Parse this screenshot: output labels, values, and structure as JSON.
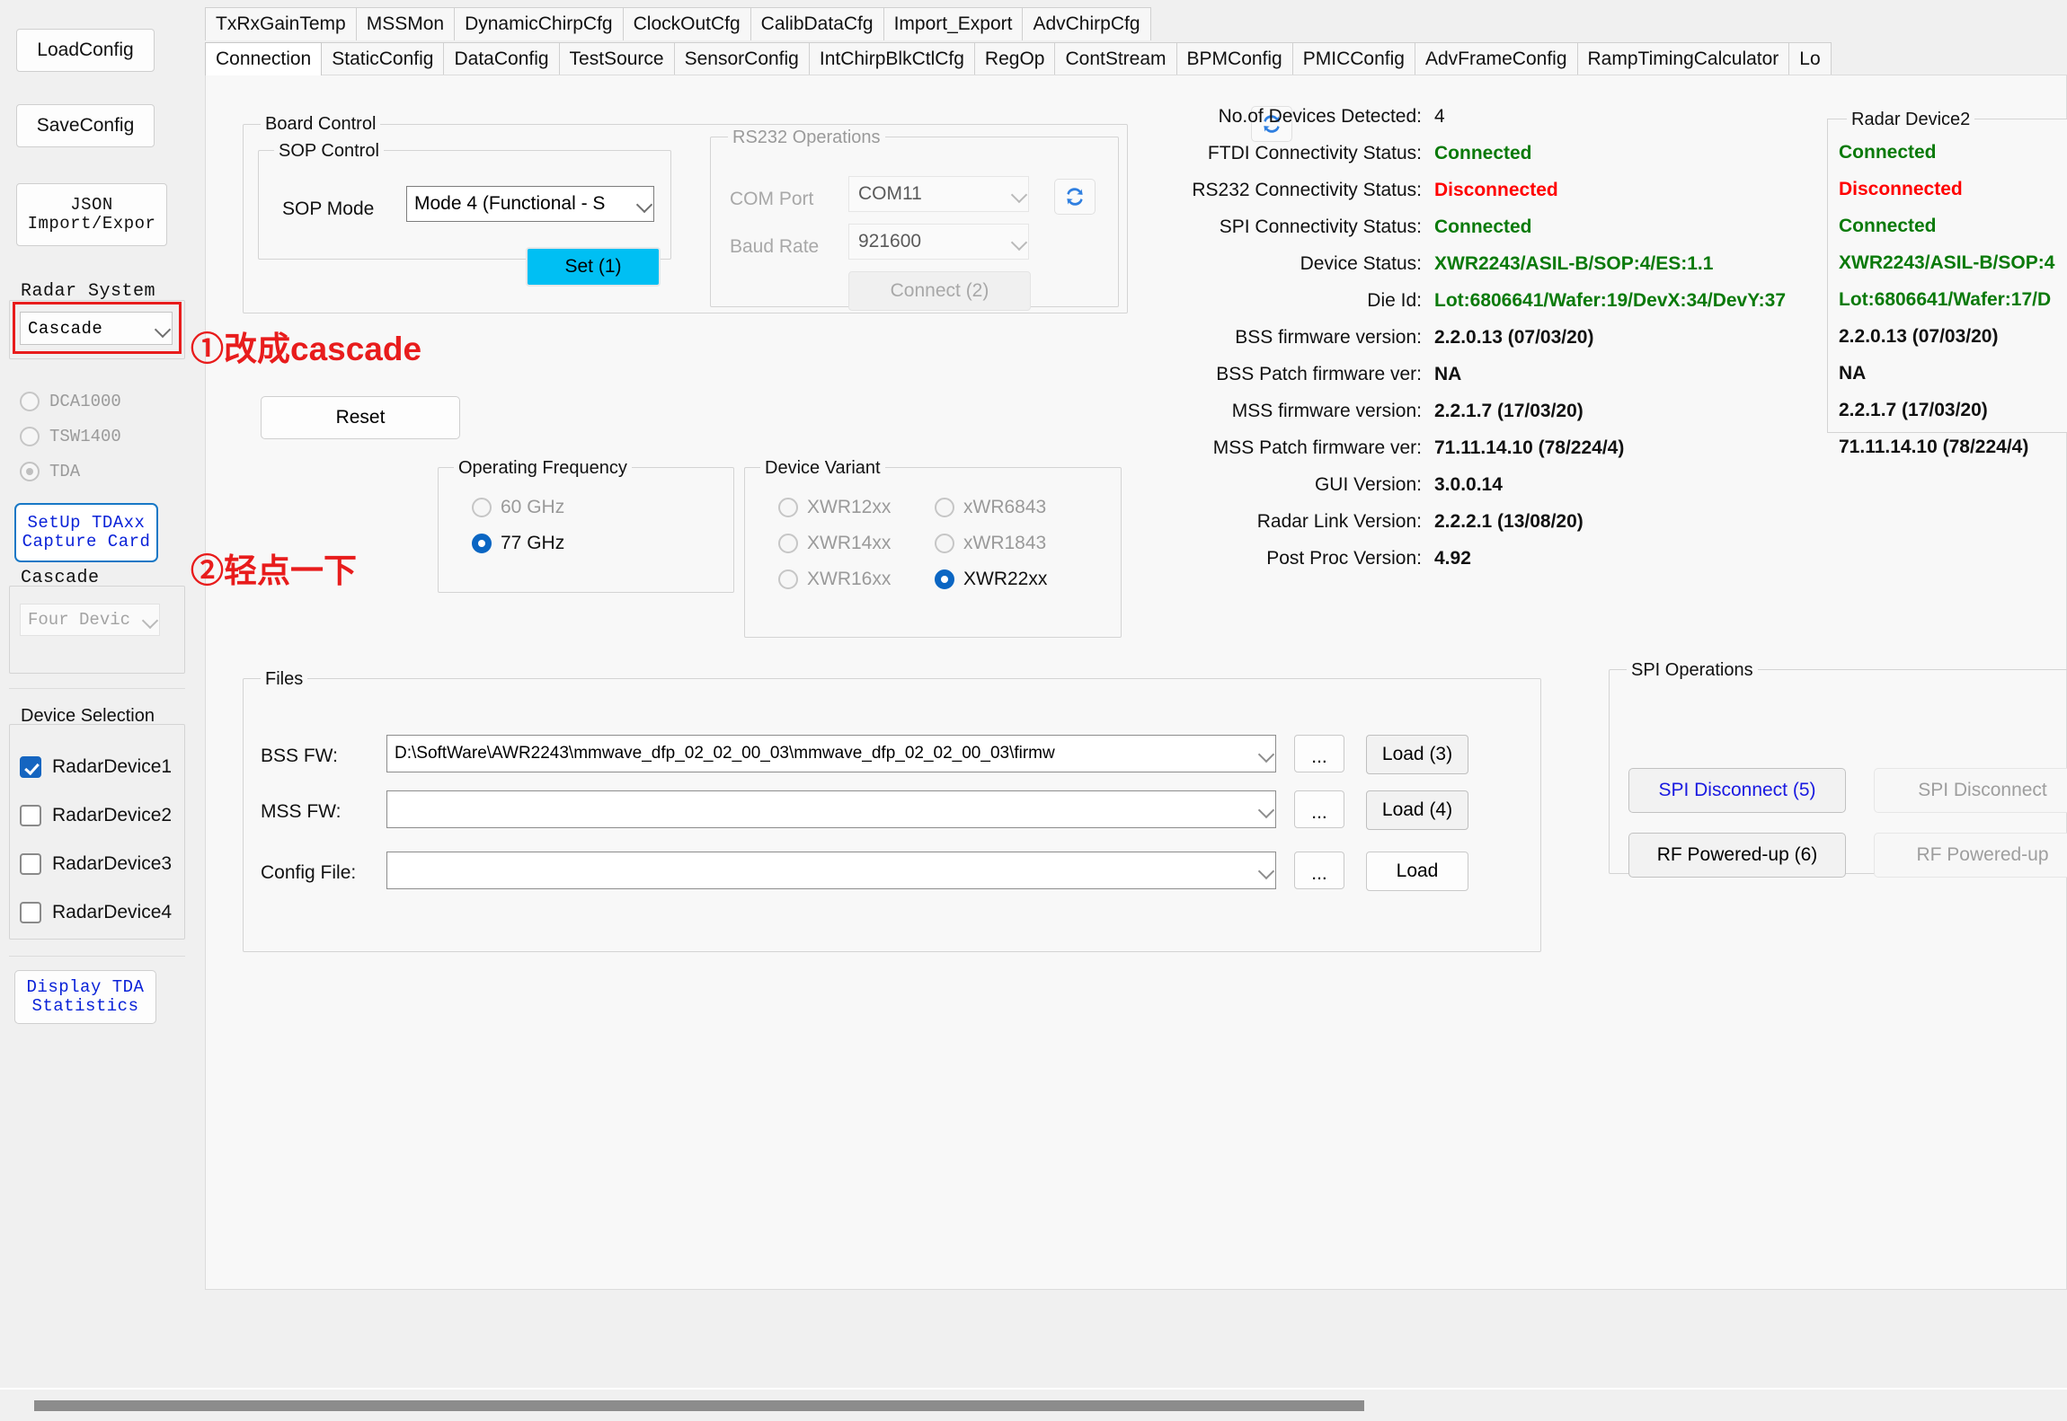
{
  "sidebar": {
    "load_config": "LoadConfig",
    "save_config": "SaveConfig",
    "json_button": "JSON\nImport/Expor",
    "radar_system": {
      "group_label": "Radar System",
      "selected": "Cascade"
    },
    "capture_radios": [
      {
        "label": "DCA1000",
        "selected": false
      },
      {
        "label": "TSW1400",
        "selected": false
      },
      {
        "label": "TDA",
        "selected": true
      }
    ],
    "setup_tda_button": "SetUp TDAxx\nCapture Card",
    "cascade": {
      "group_label": "Cascade",
      "selected": "Four Devic"
    },
    "device_selection": {
      "group_label": "Device Selection",
      "items": [
        {
          "label": "RadarDevice1",
          "checked": true
        },
        {
          "label": "RadarDevice2",
          "checked": false
        },
        {
          "label": "RadarDevice3",
          "checked": false
        },
        {
          "label": "RadarDevice4",
          "checked": false
        }
      ]
    },
    "display_tda_button": "Display TDA\nStatistics"
  },
  "tabs": {
    "row1": [
      "TxRxGainTemp",
      "MSSMon",
      "DynamicChirpCfg",
      "ClockOutCfg",
      "CalibDataCfg",
      "Import_Export",
      "AdvChirpCfg"
    ],
    "row2": [
      "Connection",
      "StaticConfig",
      "DataConfig",
      "TestSource",
      "SensorConfig",
      "IntChirpBlkCtlCfg",
      "RegOp",
      "ContStream",
      "BPMConfig",
      "PMICConfig",
      "AdvFrameConfig",
      "RampTimingCalculator",
      "Lo"
    ],
    "active": "Connection"
  },
  "board_control": {
    "group_label": "Board Control",
    "sop_control": {
      "group_label": "SOP Control",
      "sop_mode_label": "SOP Mode",
      "sop_mode_value": "Mode 4 (Functional - S",
      "set_button": "Set (1)"
    },
    "reset_button": "Reset"
  },
  "rs232": {
    "group_label": "RS232 Operations",
    "com_port_label": "COM Port",
    "com_port_value": "COM11",
    "baud_rate_label": "Baud Rate",
    "baud_rate_value": "921600",
    "connect_button": "Connect (2)"
  },
  "status": [
    {
      "key": "No.of Devices Detected:",
      "value": "4",
      "style": "plain"
    },
    {
      "key": "FTDI Connectivity Status:",
      "value": "Connected",
      "style": "green"
    },
    {
      "key": "RS232 Connectivity Status:",
      "value": "Disconnected",
      "style": "red"
    },
    {
      "key": "SPI Connectivity Status:",
      "value": "Connected",
      "style": "green"
    },
    {
      "key": "Device Status:",
      "value": "XWR2243/ASIL-B/SOP:4/ES:1.1",
      "style": "green"
    },
    {
      "key": "Die Id:",
      "value": "Lot:6806641/Wafer:19/DevX:34/DevY:37",
      "style": "green"
    },
    {
      "key": "BSS firmware version:",
      "value": "2.2.0.13 (07/03/20)",
      "style": "bold"
    },
    {
      "key": "BSS Patch firmware ver:",
      "value": "NA",
      "style": "bold"
    },
    {
      "key": "MSS firmware version:",
      "value": "2.2.1.7 (17/03/20)",
      "style": "bold"
    },
    {
      "key": "MSS Patch firmware ver:",
      "value": "71.11.14.10 (78/224/4)",
      "style": "bold"
    },
    {
      "key": "GUI Version:",
      "value": "3.0.0.14",
      "style": "bold"
    },
    {
      "key": "Radar Link Version:",
      "value": "2.2.2.1 (13/08/20)",
      "style": "bold"
    },
    {
      "key": "Post Proc Version:",
      "value": "4.92",
      "style": "bold"
    }
  ],
  "radar_device2": {
    "group_label": "Radar Device2",
    "rows": [
      {
        "value": "Connected",
        "style": "green"
      },
      {
        "value": "Disconnected",
        "style": "red"
      },
      {
        "value": "Connected",
        "style": "green"
      },
      {
        "value": "XWR2243/ASIL-B/SOP:4",
        "style": "green"
      },
      {
        "value": "Lot:6806641/Wafer:17/D",
        "style": "green"
      },
      {
        "value": "2.2.0.13 (07/03/20)",
        "style": "bold"
      },
      {
        "value": "NA",
        "style": "bold"
      },
      {
        "value": "2.2.1.7 (17/03/20)",
        "style": "bold"
      },
      {
        "value": "71.11.14.10 (78/224/4)",
        "style": "bold"
      }
    ]
  },
  "operating_frequency": {
    "group_label": "Operating Frequency",
    "options": [
      {
        "label": "60 GHz",
        "selected": false
      },
      {
        "label": "77 GHz",
        "selected": true
      }
    ]
  },
  "device_variant": {
    "group_label": "Device Variant",
    "left": [
      {
        "label": "XWR12xx",
        "selected": false
      },
      {
        "label": "XWR14xx",
        "selected": false
      },
      {
        "label": "XWR16xx",
        "selected": false
      }
    ],
    "right": [
      {
        "label": "xWR6843",
        "selected": false
      },
      {
        "label": "xWR1843",
        "selected": false
      },
      {
        "label": "XWR22xx",
        "selected": true
      }
    ]
  },
  "files": {
    "group_label": "Files",
    "rows": [
      {
        "label": "BSS FW:",
        "value": "D:\\SoftWare\\AWR2243\\mmwave_dfp_02_02_00_03\\mmwave_dfp_02_02_00_03\\firmw",
        "browse": "...",
        "load": "Load (3)"
      },
      {
        "label": "MSS FW:",
        "value": "",
        "browse": "...",
        "load": "Load (4)"
      },
      {
        "label": "Config File:",
        "value": "",
        "browse": "...",
        "load": "Load"
      }
    ]
  },
  "spi_operations": {
    "group_label": "SPI Operations",
    "buttons": [
      {
        "label": "SPI Disconnect (5)",
        "style": "blue"
      },
      {
        "label": "SPI Disconnect",
        "style": "dim"
      },
      {
        "label": "RF Powered-up (6)",
        "style": "normal"
      },
      {
        "label": "RF Powered-up",
        "style": "dim"
      }
    ]
  },
  "annotations": [
    {
      "text": "①改成cascade"
    },
    {
      "text": "②轻点一下"
    }
  ],
  "colors": {
    "accent_cyan": "#00bff3",
    "annotation_red": "#e81c1c",
    "status_green": "#0a7a0a",
    "status_red": "#ff0000",
    "link_blue": "#0a22d8"
  }
}
